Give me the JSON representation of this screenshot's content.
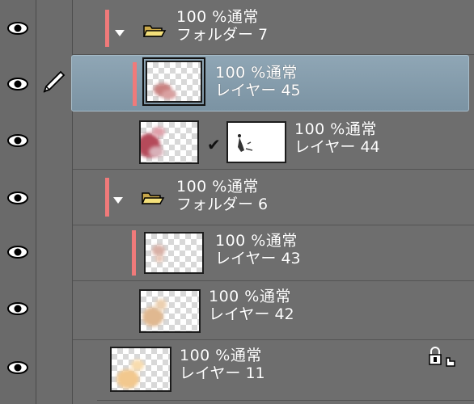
{
  "layers": [
    {
      "type": "folder",
      "opacity_mode": "100 %通常",
      "name": "フォルダー 7",
      "icon": "folder-open-icon",
      "expanded": true
    },
    {
      "type": "layer",
      "opacity_mode": "100 %通常",
      "name": "レイヤー 45",
      "selected": true,
      "icon": "pen-icon"
    },
    {
      "type": "layer",
      "opacity_mode": "100 %通常",
      "name": "レイヤー 44",
      "mask": true,
      "mask_check": "✔"
    },
    {
      "type": "folder",
      "opacity_mode": "100 %通常",
      "name": "フォルダー 6",
      "icon": "folder-open-icon",
      "expanded": true
    },
    {
      "type": "layer",
      "opacity_mode": "100 %通常",
      "name": "レイヤー 43"
    },
    {
      "type": "layer",
      "opacity_mode": "100 %通常",
      "name": "レイヤー 42"
    },
    {
      "type": "layer",
      "opacity_mode": "100 %通常",
      "name": "レイヤー 11",
      "icon": "lock-icon"
    }
  ],
  "colors": {
    "selected": "#7b93a3",
    "clip_bar": "#f07a7a",
    "panel": "#6e6e6e"
  }
}
